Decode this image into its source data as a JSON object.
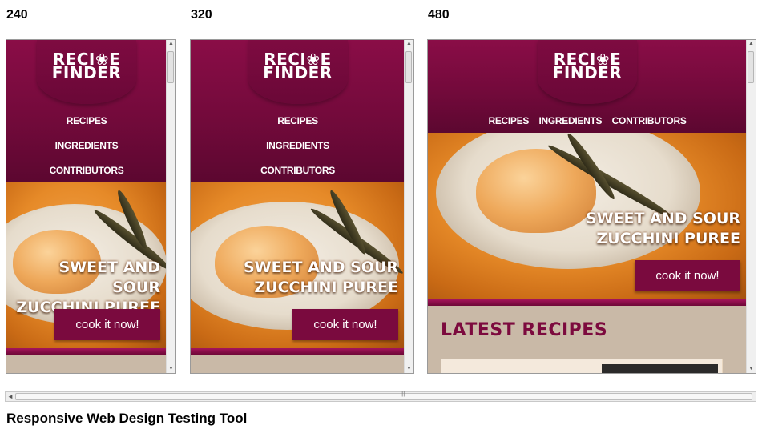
{
  "size_labels": [
    "240",
    "320",
    "480"
  ],
  "site": {
    "logo_line1": "RECI❀E",
    "logo_line2": "FINDER",
    "nav": [
      "RECIPES",
      "INGREDIENTS",
      "CONTRIBUTORS"
    ],
    "hero_title_line1": "SWEET AND SOUR",
    "hero_title_line2": "ZUCCHINI PUREE",
    "cta": "cook it now!",
    "latest_title": "LATEST RECIPES"
  },
  "hscroll_grip": "|||",
  "tool_title": "Responsive Web Design Testing Tool",
  "colors": {
    "brand": "#7a0a3e",
    "hero": "#e68a28",
    "page_bg": "#c9b9a7"
  }
}
